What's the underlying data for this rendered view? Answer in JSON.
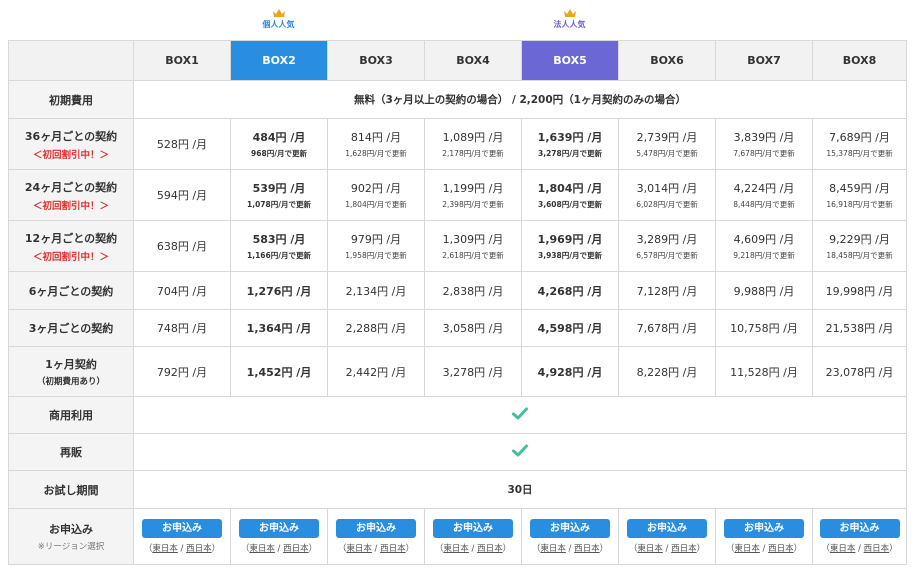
{
  "badges": {
    "personal": "個人人気",
    "corporate": "法人人気"
  },
  "columns": [
    "",
    "BOX1",
    "BOX2",
    "BOX3",
    "BOX4",
    "BOX5",
    "BOX6",
    "BOX7",
    "BOX8"
  ],
  "rows": {
    "initial_fee": {
      "label": "初期費用",
      "value": "無料（3ヶ月以上の契約の場合） / 2,200円（1ヶ月契約のみの場合）"
    },
    "m36": {
      "label": "36ヶ月ごとの契約",
      "sub": "＜初回割引中！＞",
      "prices": [
        "528円 /月",
        "484円 /月",
        "814円 /月",
        "1,089円 /月",
        "1,639円 /月",
        "2,739円 /月",
        "3,839円 /月",
        "7,689円 /月"
      ],
      "updates": [
        "",
        "968円/月で更新",
        "1,628円/月で更新",
        "2,178円/月で更新",
        "3,278円/月で更新",
        "5,478円/月で更新",
        "7,678円/月で更新",
        "15,378円/月で更新"
      ]
    },
    "m24": {
      "label": "24ヶ月ごとの契約",
      "sub": "＜初回割引中！＞",
      "prices": [
        "594円 /月",
        "539円 /月",
        "902円 /月",
        "1,199円 /月",
        "1,804円 /月",
        "3,014円 /月",
        "4,224円 /月",
        "8,459円 /月"
      ],
      "updates": [
        "",
        "1,078円/月で更新",
        "1,804円/月で更新",
        "2,398円/月で更新",
        "3,608円/月で更新",
        "6,028円/月で更新",
        "8,448円/月で更新",
        "16,918円/月で更新"
      ]
    },
    "m12": {
      "label": "12ヶ月ごとの契約",
      "sub": "＜初回割引中！＞",
      "prices": [
        "638円 /月",
        "583円 /月",
        "979円 /月",
        "1,309円 /月",
        "1,969円 /月",
        "3,289円 /月",
        "4,609円 /月",
        "9,229円 /月"
      ],
      "updates": [
        "",
        "1,166円/月で更新",
        "1,958円/月で更新",
        "2,618円/月で更新",
        "3,938円/月で更新",
        "6,578円/月で更新",
        "9,218円/月で更新",
        "18,458円/月で更新"
      ]
    },
    "m6": {
      "label": "6ヶ月ごとの契約",
      "prices": [
        "704円 /月",
        "1,276円 /月",
        "2,134円 /月",
        "2,838円 /月",
        "4,268円 /月",
        "7,128円 /月",
        "9,988円 /月",
        "19,998円 /月"
      ]
    },
    "m3": {
      "label": "3ヶ月ごとの契約",
      "prices": [
        "748円 /月",
        "1,364円 /月",
        "2,288円 /月",
        "3,058円 /月",
        "4,598円 /月",
        "7,678円 /月",
        "10,758円 /月",
        "21,538円 /月"
      ]
    },
    "m1": {
      "label": "1ヶ月契約",
      "sub": "（初期費用あり）",
      "prices": [
        "792円 /月",
        "1,452円 /月",
        "2,442円 /月",
        "3,278円 /月",
        "4,928円 /月",
        "8,228円 /月",
        "11,528円 /月",
        "23,078円 /月"
      ]
    },
    "commercial": {
      "label": "商用利用",
      "icon": "check-icon"
    },
    "resale": {
      "label": "再販",
      "icon": "check-icon"
    },
    "trial": {
      "label": "お試し期間",
      "value": "30日"
    },
    "apply": {
      "label": "お申込み",
      "sub": "※リージョン選択",
      "button": "お申込み",
      "region_open": "（",
      "region_east": "東日本",
      "region_sep": " / ",
      "region_west": "西日本",
      "region_close": "）"
    }
  },
  "colors": {
    "accent_blue": "#2a8ee0",
    "accent_purple": "#6b68d6",
    "check_green": "#3fbf9f",
    "discount_red": "#e03030"
  }
}
